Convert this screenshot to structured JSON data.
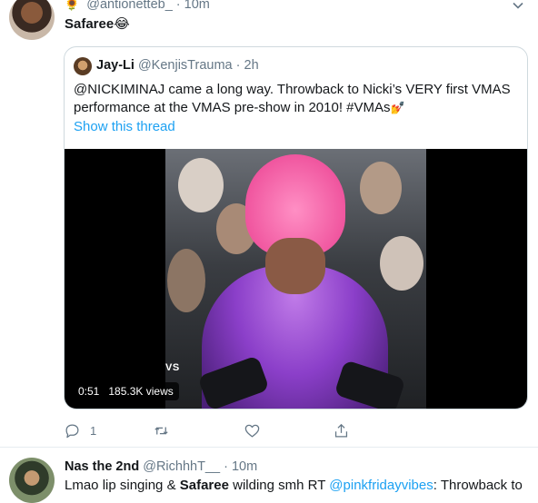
{
  "tweet1": {
    "flower_emoji": "🌻",
    "handle": "@antionetteb_",
    "separator": "·",
    "time": "10m",
    "text": "Safaree😂",
    "quote": {
      "name": "Jay-Li",
      "handle": "@KenjisTrauma",
      "separator": "·",
      "time": "2h",
      "body_text": "@NICKIMINAJ came a long way. Throwback to Nicki’s VERY first VMAS performance at the VMAS pre-show in 2010! #VMAs",
      "body_emoji": "💅",
      "show_thread": "Show this thread",
      "video": {
        "watermark": "VS",
        "duration": "0:51",
        "views": "185.3K views"
      }
    },
    "actions": {
      "reply_count": "1",
      "retweet_count": "",
      "like_count": ""
    }
  },
  "tweet2": {
    "name": "Nas the 2nd",
    "handle": "@RichhhT__",
    "separator": "·",
    "time": "10m",
    "text_pre": "Lmao lip singing & ",
    "text_bold": "Safaree",
    "text_mid": " wilding smh RT ",
    "mention": "@pinkfridayvibes",
    "text_post": ": Throwback to"
  },
  "icons": {
    "more": "chevron-down-icon",
    "reply": "reply-icon",
    "retweet": "retweet-icon",
    "like": "heart-icon",
    "share": "share-icon"
  },
  "colors": {
    "link_blue": "#1da1f2",
    "secondary_text": "#657786",
    "border": "#e6ecf0"
  }
}
